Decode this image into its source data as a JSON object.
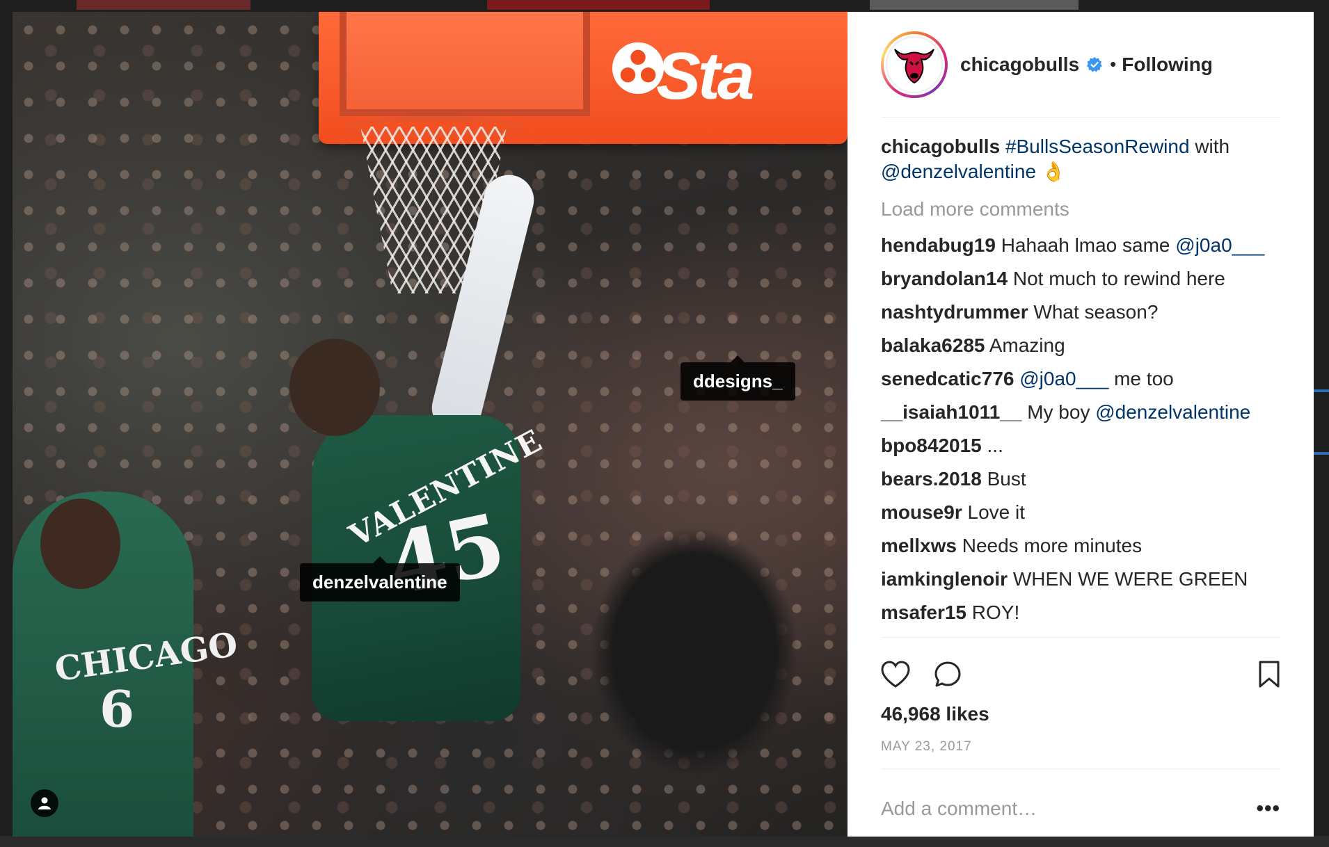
{
  "post": {
    "username": "chicagobulls",
    "verified": true,
    "dot": "•",
    "follow_status": "Following",
    "photo": {
      "sponsor_text": "Sta",
      "jersey_name": "VALENTINE",
      "jersey_number": "45",
      "team_text": "CHICAGO",
      "team_number": "6",
      "tags": [
        "ddesigns_",
        "denzelvalentine"
      ]
    },
    "caption": {
      "username": "chicagobulls",
      "hashtag": "#BullsSeasonRewind",
      "text_mid": " with",
      "mention": "@denzelvalentine",
      "emoji": "👌"
    },
    "load_more": "Load more comments",
    "comments": [
      {
        "user": "hendabug19",
        "text": "Hahaah lmao same ",
        "mention": "@j0a0___",
        "after": ""
      },
      {
        "user": "bryandolan14",
        "text": "Not much to rewind here",
        "mention": "",
        "after": ""
      },
      {
        "user": "nashtydrummer",
        "text": "What season?",
        "mention": "",
        "after": ""
      },
      {
        "user": "balaka6285",
        "text": "Amazing",
        "mention": "",
        "after": ""
      },
      {
        "user": "senedcatic776",
        "text": "",
        "mention": "@j0a0___",
        "after": " me too"
      },
      {
        "user": "__isaiah1011__",
        "text": "My boy ",
        "mention": "@denzelvalentine",
        "after": ""
      },
      {
        "user": "bpo842015",
        "text": "...",
        "mention": "",
        "after": ""
      },
      {
        "user": "bears.2018",
        "text": "Bust",
        "mention": "",
        "after": ""
      },
      {
        "user": "mouse9r",
        "text": "Love it",
        "mention": "",
        "after": ""
      },
      {
        "user": "mellxws",
        "text": "Needs more minutes",
        "mention": "",
        "after": ""
      },
      {
        "user": "iamkinglenoir",
        "text": "WHEN WE WERE GREEN",
        "mention": "",
        "after": ""
      },
      {
        "user": "msafer15",
        "text": "ROY!",
        "mention": "",
        "after": ""
      }
    ],
    "likes": "46,968 likes",
    "date": "MAY 23, 2017",
    "add_comment_placeholder": "Add a comment…",
    "more_label": "•••"
  },
  "icons": {
    "like": "heart-icon",
    "comment": "comment-icon",
    "save": "bookmark-icon",
    "user_tags": "user-icon",
    "verified": "verified-badge-icon",
    "avatar": "bulls-logo-icon"
  },
  "colors": {
    "link": "#003569",
    "verified": "#3897f0",
    "muted": "#999999",
    "text": "#262626"
  }
}
